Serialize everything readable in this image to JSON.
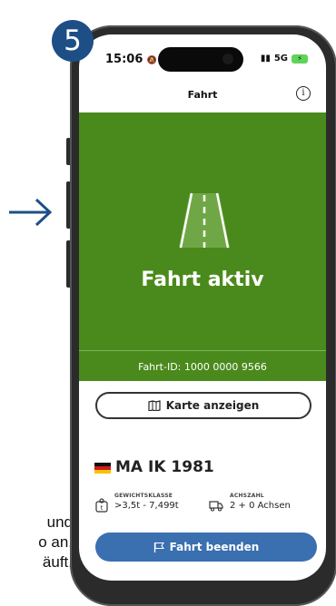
{
  "step_number": "5",
  "cutoff_text": [
    "und",
    "o an,",
    "äuft."
  ],
  "status_bar": {
    "time": "15:06",
    "bell_glyph": "🔕",
    "network": "5G",
    "battery_icon": "charging"
  },
  "header": {
    "title": "Fahrt",
    "info_icon": "info-icon"
  },
  "trip": {
    "status": "Fahrt aktiv",
    "trip_id_label": "Fahrt-ID: 1000 0000 9566"
  },
  "map_button": {
    "label": "Karte anzeigen",
    "icon": "map-icon"
  },
  "vehicle": {
    "plate": "MA IK 1981",
    "country_flag": "germany-flag",
    "weight_class": {
      "label": "GEWICHTSKLASSE",
      "value": ">3,5t - 7,499t"
    },
    "axles": {
      "label": "ACHSZAHL",
      "value": "2 + 0 Achsen"
    }
  },
  "end_button": {
    "label": "Fahrt beenden",
    "icon": "finish-flag-icon"
  },
  "colors": {
    "green": "#4a8a1c",
    "button_blue": "#3a6fb0",
    "badge_blue": "#1d4f86"
  }
}
